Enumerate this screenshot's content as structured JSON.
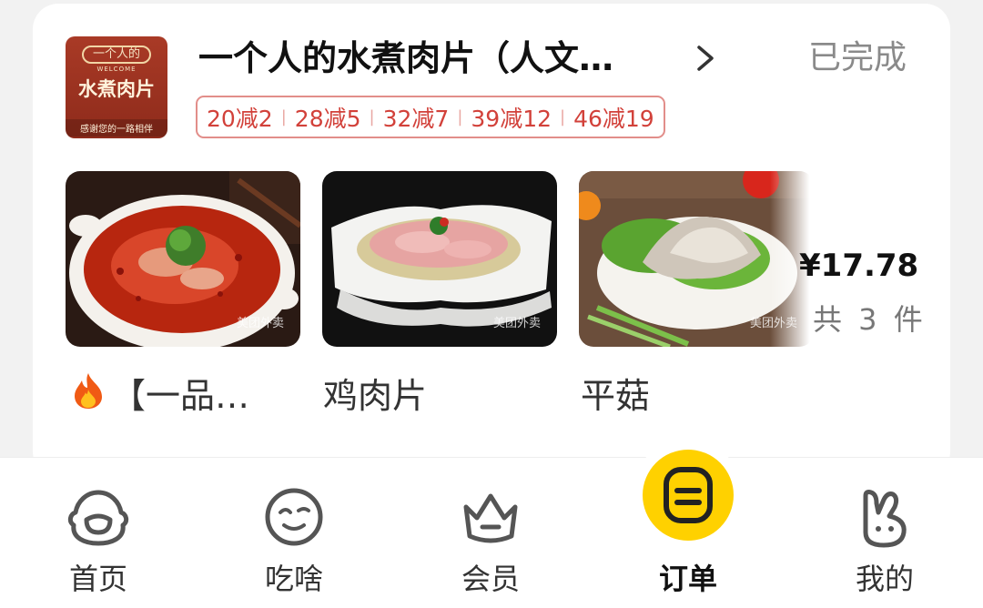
{
  "order": {
    "store_name": "一个人的水煮肉片（人文…",
    "status": "已完成",
    "logo": {
      "top_text": "一个人的",
      "welcome": "WELCOME",
      "main_text": "水煮肉片",
      "bottom_text": "感谢您的一路相伴"
    },
    "discounts": [
      "20减2",
      "28减5",
      "32减7",
      "39减12",
      "46减19"
    ],
    "items": [
      {
        "name": "【一品…",
        "icon": "fire-icon"
      },
      {
        "name": "鸡肉片"
      },
      {
        "name": "平菇"
      }
    ],
    "watermark": "美团外卖",
    "price": "¥17.78",
    "count": "共 3 件"
  },
  "tabbar": {
    "tabs": [
      {
        "label": "首页",
        "icon": "home-icon"
      },
      {
        "label": "吃啥",
        "icon": "smiley-icon"
      },
      {
        "label": "会员",
        "icon": "crown-icon"
      },
      {
        "label": "订单",
        "icon": "orders-icon",
        "active": true
      },
      {
        "label": "我的",
        "icon": "rabbit-icon"
      }
    ],
    "active_color": "#ffd100"
  }
}
